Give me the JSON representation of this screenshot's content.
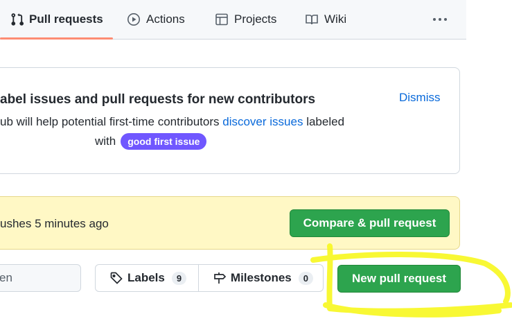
{
  "tabs": [
    {
      "label": "Pull requests",
      "icon": "git-pull-request-icon",
      "active": true
    },
    {
      "label": "Actions",
      "icon": "play-icon"
    },
    {
      "label": "Projects",
      "icon": "table-icon"
    },
    {
      "label": "Wiki",
      "icon": "book-icon"
    }
  ],
  "card": {
    "title": "abel issues and pull requests for new contributors",
    "desc_prefix": "ub will help potential first-time contributors ",
    "desc_link": "discover issues",
    "desc_suffix": " labeled",
    "with_text": "with",
    "label_name": "good first issue",
    "dismiss": "Dismiss"
  },
  "banner": {
    "text": "ushes 5 minutes ago",
    "compare_button": "Compare & pull request"
  },
  "toolbar": {
    "filter_value": "en",
    "labels_label": "Labels",
    "labels_count": "9",
    "milestones_label": "Milestones",
    "milestones_count": "0",
    "new_pr_button": "New pull request"
  },
  "colors": {
    "accent_green": "#2da44e",
    "label_purple": "#7057ff",
    "link_blue": "#0969da",
    "banner_yellow": "#fff8c5",
    "tab_underline": "#fd8c73",
    "annotation_yellow": "#f7f71e"
  }
}
